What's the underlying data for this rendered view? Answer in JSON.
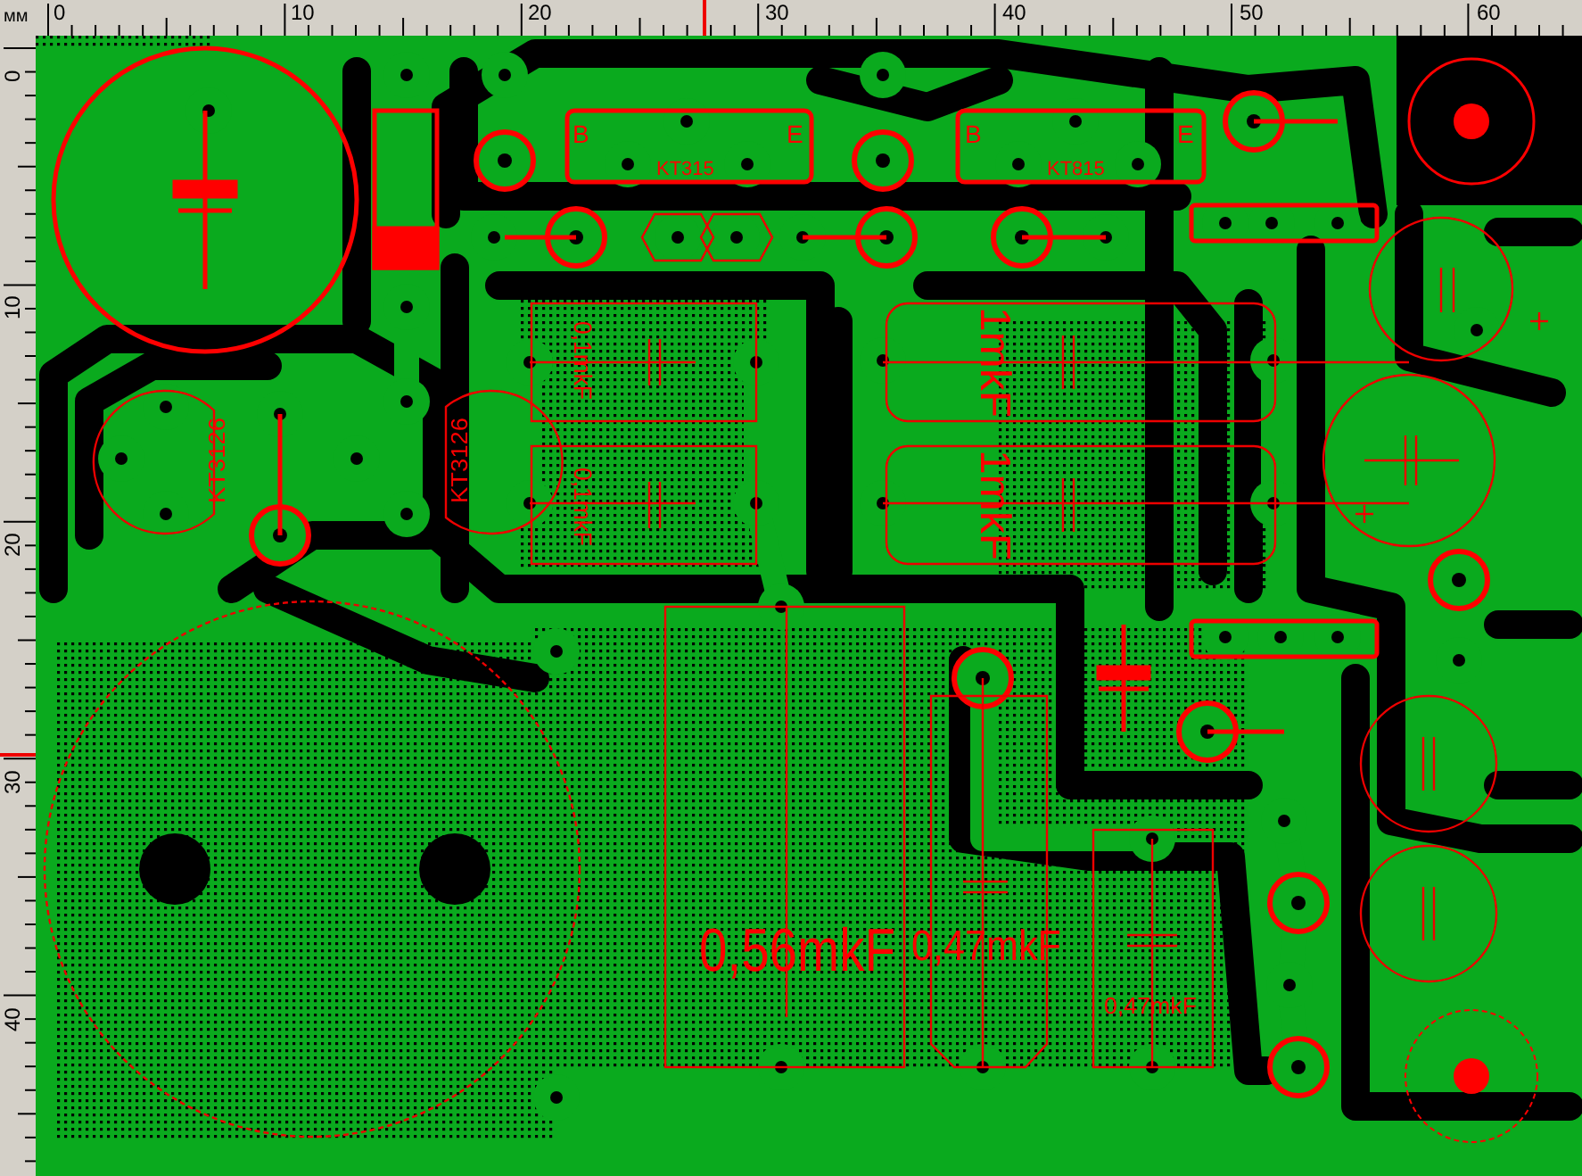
{
  "ruler": {
    "unit": "мм",
    "x_labels": [
      "0",
      "10",
      "20",
      "30",
      "40",
      "50",
      "60"
    ],
    "y_labels": [
      "0",
      "10",
      "20",
      "30",
      "40"
    ]
  },
  "board": {
    "labels": [
      {
        "text": "B",
        "kind": "normal"
      },
      {
        "text": "E",
        "kind": "normal"
      },
      {
        "text": "KT315",
        "kind": "normal"
      },
      {
        "text": "B",
        "kind": "normal"
      },
      {
        "text": "E",
        "kind": "normal"
      },
      {
        "text": "KT815",
        "kind": "normal"
      },
      {
        "text": "0,1mkF",
        "kind": "rotated_cw"
      },
      {
        "text": "0,1mkF",
        "kind": "rotated_cw"
      },
      {
        "text": "1mkF",
        "kind": "rotated_cw"
      },
      {
        "text": "1mkF",
        "kind": "rotated_cw"
      },
      {
        "text": "KT3126",
        "kind": "rotated_ccw"
      },
      {
        "text": "KT3126",
        "kind": "rotated_ccw"
      },
      {
        "text": "0,56mkF",
        "kind": "normal"
      },
      {
        "text": "0,47mkF",
        "kind": "normal"
      },
      {
        "text": "0,47mkF",
        "kind": "normal"
      }
    ]
  }
}
